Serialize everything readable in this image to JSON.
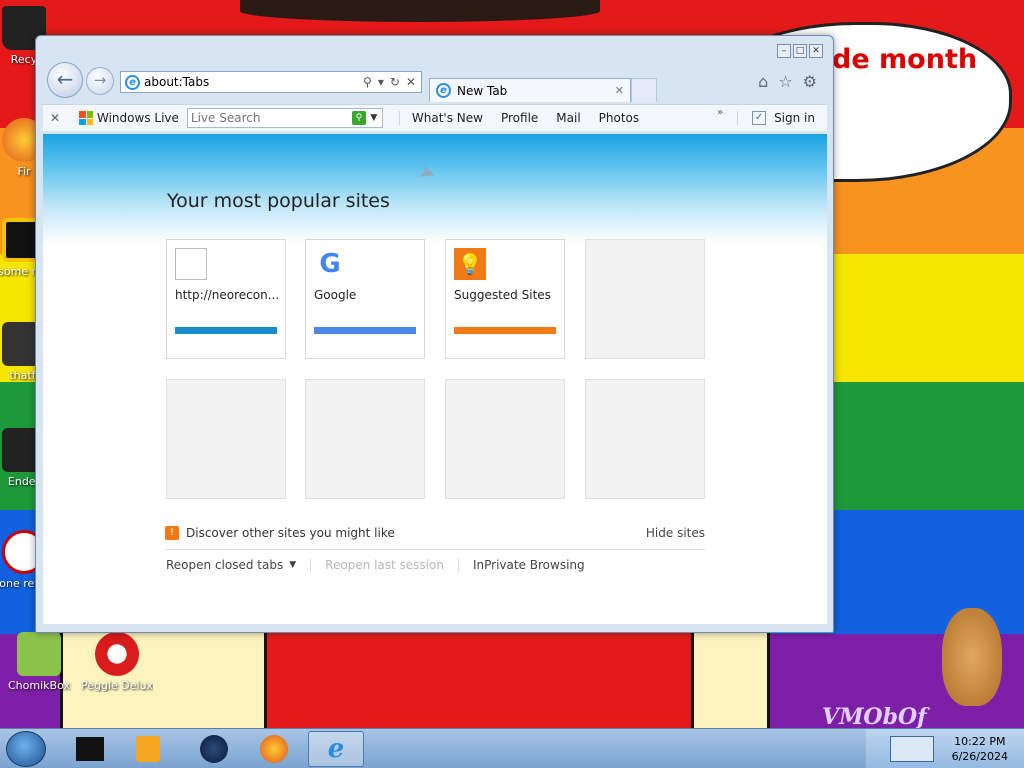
{
  "desktop": {
    "bubble_text": "de month",
    "icons": [
      {
        "name": "recycle-bin",
        "label": "Recy"
      },
      {
        "name": "firefox",
        "label": "Fir"
      },
      {
        "name": "some-rant",
        "label": "some ran"
      },
      {
        "name": "thatfile",
        "label": "thatfi"
      },
      {
        "name": "ender",
        "label": "Ender"
      },
      {
        "name": "none-retard",
        "label": "none retarc"
      },
      {
        "name": "chomikbox",
        "label": "ChomikBox"
      },
      {
        "name": "peggle-deluxe",
        "label": "Peggle Deluxe"
      }
    ],
    "watermark": "VMObOf"
  },
  "browser": {
    "address": "about:Tabs",
    "tab_title": "New Tab",
    "command_bar": {
      "windows_live": "Windows Live",
      "search_placeholder": "Live Search",
      "links": [
        "What's New",
        "Profile",
        "Mail",
        "Photos"
      ],
      "sign_in": "Sign in"
    },
    "new_tab_page": {
      "heading": "Your most popular sites",
      "tiles": [
        {
          "title": "http://neorecon...",
          "bar_color": "#1a8cc9"
        },
        {
          "title": "Google",
          "bar_color": "#4a86e8"
        },
        {
          "title": "Suggested Sites",
          "bar_color": "#f17a16"
        }
      ],
      "discover_text": "Discover other sites you might like",
      "hide_sites": "Hide sites",
      "reopen_closed_tabs": "Reopen closed tabs",
      "reopen_last_session": "Reopen last session",
      "inprivate": "InPrivate Browsing"
    }
  },
  "taskbar": {
    "time": "10:22 PM",
    "date": "6/26/2024"
  }
}
